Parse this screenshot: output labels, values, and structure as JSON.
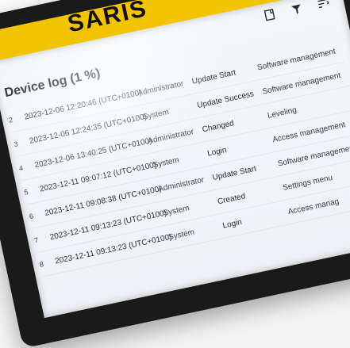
{
  "brand": {
    "text": "SARIS"
  },
  "toolbar": {
    "export_icon": "document-icon",
    "filter_icon": "funnel-icon",
    "sort_icon": "sort-icon"
  },
  "log": {
    "title": "Device log (1 %)",
    "rows": [
      {
        "idx": "2",
        "date": "2023-12-06 12:20:46 (UTC+0100)",
        "user": "Administrator",
        "event": "Update Start",
        "category": "Software management"
      },
      {
        "idx": "3",
        "date": "2023-12-06 12:24:35 (UTC+0100)",
        "user": "System",
        "event": "Update Success",
        "category": "Software management"
      },
      {
        "idx": "4",
        "date": "2023-12-06 13:40:25 (UTC+0100)",
        "user": "Administrator",
        "event": "Changed",
        "category": "Leveling"
      },
      {
        "idx": "5",
        "date": "2023-12-11 09:07:12 (UTC+0100)",
        "user": "System",
        "event": "Login",
        "category": "Access management"
      },
      {
        "idx": "6",
        "date": "2023-12-11 09:08:38 (UTC+0100)",
        "user": "Administrator",
        "event": "Update Start",
        "category": "Software management"
      },
      {
        "idx": "7",
        "date": "2023-12-11 09:13:23 (UTC+0100)",
        "user": "System",
        "event": "Created",
        "category": "Settings menu"
      },
      {
        "idx": "8",
        "date": "2023-12-11 09:13:23 (UTC+0100)",
        "user": "System",
        "event": "Login",
        "category": "Access manag"
      }
    ]
  }
}
